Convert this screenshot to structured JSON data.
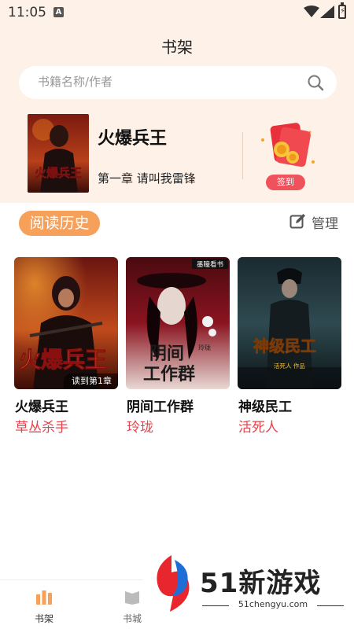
{
  "status_bar": {
    "time": "11:05",
    "notification_glyph": "A"
  },
  "header": {
    "title": "书架"
  },
  "search": {
    "placeholder": "书籍名称/作者"
  },
  "recent_book": {
    "title": "火爆兵王",
    "chapter": "第一章 请叫我雷锋",
    "signin_label": "签到"
  },
  "history": {
    "label": "阅读历史",
    "manage_label": "管理"
  },
  "books": [
    {
      "title": "火爆兵王",
      "author": "草丛杀手",
      "progress": "读到第1章",
      "cover_text": "火爆兵王"
    },
    {
      "title": "阴间工作群",
      "author": "玲珑",
      "cover_text": "阴间工作群",
      "cover_publisher": "墨瞳看书",
      "cover_author": "玲珑"
    },
    {
      "title": "神级民工",
      "author": "活死人",
      "cover_text": "神级民工",
      "cover_author": "活死人 作品"
    }
  ],
  "bottom_nav": [
    {
      "label": "书架",
      "icon": "bookshelf-icon",
      "active": true
    },
    {
      "label": "书城",
      "icon": "bookstore-icon",
      "active": false
    }
  ],
  "watermark": {
    "brand": "51新游戏",
    "url": "51chengyu.com"
  },
  "colors": {
    "accent": "#f6a05a",
    "author_red": "#e8424c",
    "header_bg": "#fdf1e8",
    "signin_red": "#f0525c"
  }
}
